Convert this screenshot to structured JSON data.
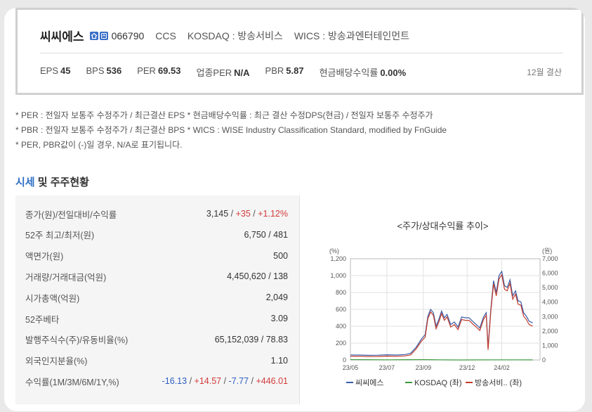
{
  "company": {
    "name": "씨씨에스",
    "code": "066790",
    "english": "CCS",
    "market": "KOSDAQ : 방송서비스",
    "wics": "WICS : 방송과엔터테인먼트",
    "icons": [
      "home-icon",
      "home-icon-outline"
    ]
  },
  "stats": [
    {
      "label": "EPS",
      "value": "45"
    },
    {
      "label": "BPS",
      "value": "536"
    },
    {
      "label": "PER",
      "value": "69.53"
    },
    {
      "label": "업종PER",
      "value": "N/A"
    },
    {
      "label": "PBR",
      "value": "5.87"
    },
    {
      "label": "현금배당수익률",
      "value": "0.00%"
    }
  ],
  "settlement": "12월 결산",
  "notes": [
    "* PER : 전일자 보통주 수정주가 / 최근결산 EPS * 현금배당수익률 : 최근 결산 수정DPS(현금) / 전일자 보통주 수정주가",
    "* PBR : 전일자 보통주 수정주가 / 최근결산 BPS * WICS : WISE Industry Classification Standard, modified by FnGuide",
    "* PER, PBR값이 (-)일 경우, N/A로 표기됩니다."
  ],
  "section": {
    "accent": "시세",
    "rest": " 및 주주현황"
  },
  "table": {
    "rows": [
      {
        "label": "종가(원)/전일대비/수익률",
        "parts": [
          {
            "t": "3,145",
            "c": ""
          },
          {
            "t": " / ",
            "c": "sep"
          },
          {
            "t": "+35",
            "c": "red"
          },
          {
            "t": " / ",
            "c": "sep"
          },
          {
            "t": "+1.12%",
            "c": "red"
          }
        ]
      },
      {
        "label": "52주 최고/최저(원)",
        "parts": [
          {
            "t": "6,750 / 481",
            "c": ""
          }
        ]
      },
      {
        "label": "액면가(원)",
        "parts": [
          {
            "t": "500",
            "c": ""
          }
        ]
      },
      {
        "label": "거래량/거래대금(억원)",
        "parts": [
          {
            "t": "4,450,620 / 138",
            "c": ""
          }
        ]
      },
      {
        "label": "시가총액(억원)",
        "parts": [
          {
            "t": "2,049",
            "c": ""
          }
        ]
      },
      {
        "label": "52주베타",
        "parts": [
          {
            "t": "3.09",
            "c": ""
          }
        ]
      },
      {
        "label": "발행주식수(주)/유동비율(%)",
        "parts": [
          {
            "t": "65,152,039 / 78.83",
            "c": ""
          }
        ]
      },
      {
        "label": "외국인지분율(%)",
        "parts": [
          {
            "t": "1.10",
            "c": ""
          }
        ]
      },
      {
        "label": "수익률(1M/3M/6M/1Y,%)",
        "parts": [
          {
            "t": "-16.13",
            "c": "blue"
          },
          {
            "t": " / ",
            "c": "sep"
          },
          {
            "t": "+14.57",
            "c": "red"
          },
          {
            "t": " / ",
            "c": "sep"
          },
          {
            "t": "-7.77",
            "c": "blue"
          },
          {
            "t": " / ",
            "c": "sep"
          },
          {
            "t": "+446.01",
            "c": "red"
          }
        ]
      }
    ]
  },
  "chart_title": "<주가/상대수익률 추이>",
  "chart_data": {
    "type": "line",
    "title": "<주가/상대수익률 추이>",
    "left_unit": "(%)",
    "right_unit": "(원)",
    "left_ticks": [
      "1,200",
      "1,000",
      "800",
      "600",
      "400",
      "200",
      "0"
    ],
    "right_ticks": [
      "7,000",
      "6,000",
      "5,000",
      "4,000",
      "3,000",
      "2,000",
      "1,000",
      "0"
    ],
    "ylim_left": [
      0,
      1200
    ],
    "ylim_right": [
      0,
      7000
    ],
    "x_ticks": [
      "23/05",
      "23/07",
      "23/09",
      "23/12",
      "24/02"
    ],
    "x_tick_pos": [
      0,
      2,
      4,
      6.4,
      8.3
    ],
    "x_range": [
      0,
      10.4
    ],
    "grid": true,
    "legend_position": "bottom",
    "series": [
      {
        "name": "씨씨에스",
        "color": "#3a5ba8",
        "axis": "left",
        "x": [
          0,
          0.5,
          1,
          1.5,
          2,
          2.5,
          3,
          3.3,
          3.6,
          3.9,
          4.1,
          4.25,
          4.4,
          4.55,
          4.7,
          4.85,
          5,
          5.15,
          5.3,
          5.5,
          5.7,
          5.9,
          6.1,
          6.3,
          6.5,
          6.7,
          6.9,
          7.1,
          7.3,
          7.45,
          7.55,
          7.7,
          7.85,
          8,
          8.15,
          8.3,
          8.45,
          8.6,
          8.75,
          8.9,
          9.05,
          9.2,
          9.35,
          9.5,
          9.65,
          9.8,
          10.0
        ],
        "y": [
          60,
          58,
          55,
          57,
          62,
          58,
          64,
          80,
          150,
          250,
          300,
          520,
          600,
          560,
          400,
          480,
          580,
          500,
          540,
          420,
          450,
          390,
          510,
          500,
          500,
          460,
          420,
          380,
          510,
          560,
          150,
          600,
          940,
          800,
          1000,
          1050,
          880,
          860,
          950,
          760,
          820,
          700,
          690,
          560,
          520,
          460,
          440
        ]
      },
      {
        "name": "KOSDAQ (좌)",
        "color": "#3c9a3c",
        "axis": "left",
        "x": [
          0,
          1,
          2,
          3,
          4,
          5,
          6,
          7,
          8,
          9,
          10
        ],
        "y": [
          4,
          3,
          2,
          3,
          4,
          2,
          0,
          1,
          2,
          2,
          1
        ]
      },
      {
        "name": "방송서비.. (좌)",
        "color": "#c23b2b",
        "axis": "left",
        "x": [
          0,
          0.5,
          1,
          1.5,
          2,
          2.5,
          3,
          3.3,
          3.6,
          3.9,
          4.1,
          4.25,
          4.4,
          4.55,
          4.7,
          4.85,
          5,
          5.15,
          5.3,
          5.5,
          5.7,
          5.9,
          6.1,
          6.3,
          6.5,
          6.7,
          6.9,
          7.1,
          7.3,
          7.45,
          7.55,
          7.7,
          7.85,
          8,
          8.15,
          8.3,
          8.45,
          8.6,
          8.75,
          8.9,
          9.05,
          9.2,
          9.35,
          9.5,
          9.65,
          9.8,
          10.0
        ],
        "y": [
          45,
          43,
          40,
          42,
          46,
          43,
          48,
          60,
          130,
          225,
          270,
          490,
          570,
          530,
          370,
          450,
          550,
          470,
          510,
          390,
          420,
          360,
          480,
          470,
          470,
          430,
          390,
          350,
          480,
          530,
          120,
          570,
          900,
          760,
          960,
          1010,
          840,
          820,
          910,
          720,
          780,
          660,
          650,
          520,
          480,
          420,
          400
        ]
      }
    ]
  }
}
